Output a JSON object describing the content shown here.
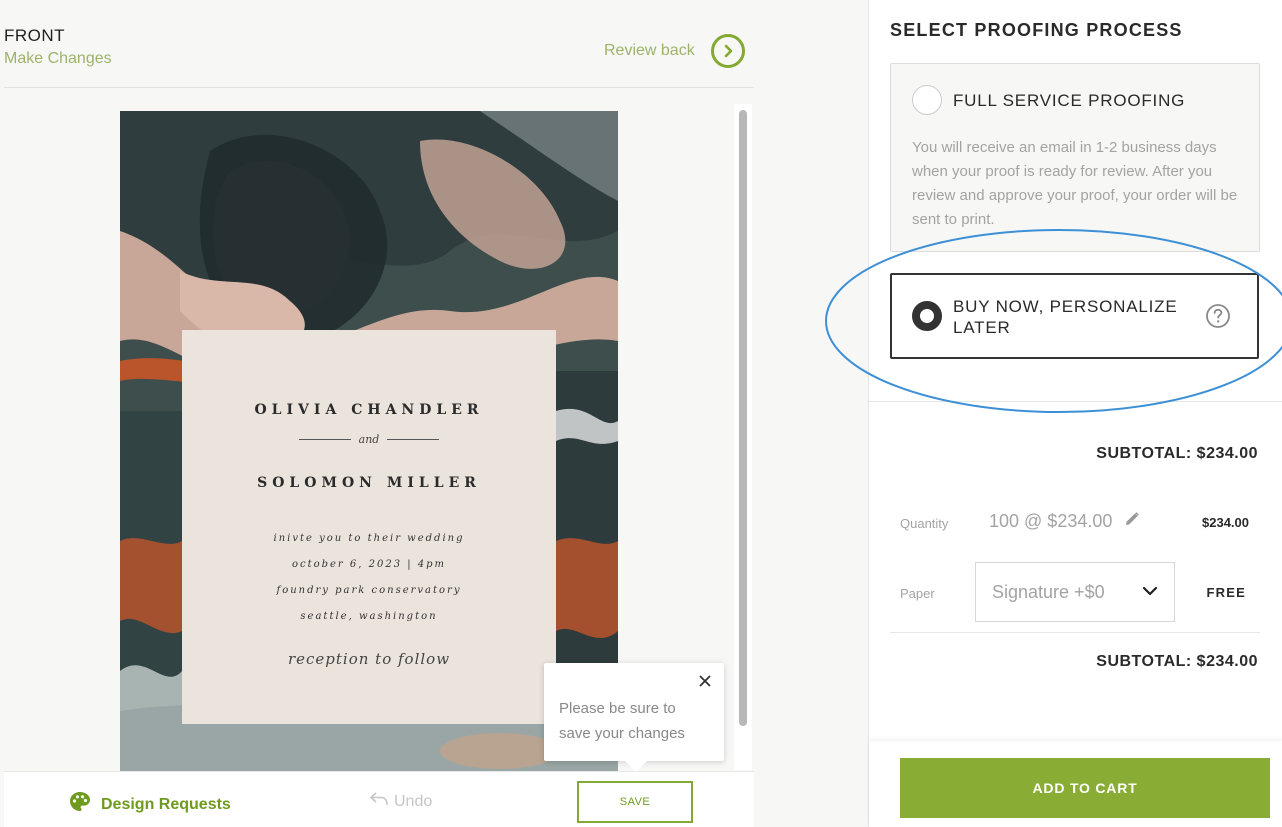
{
  "editor": {
    "side_title": "FRONT",
    "side_subtitle": "Make Changes",
    "review_link": "Review back"
  },
  "card": {
    "name1": "OLIVIA CHANDLER",
    "and": "and",
    "name2": "SOLOMON MILLER",
    "details": [
      "inivte you to their wedding",
      "october 6, 2023 | 4pm",
      "foundry park conservatory",
      "seattle, washington"
    ],
    "closing": "reception to follow"
  },
  "tooltip": {
    "text": "Please be sure to save your changes"
  },
  "bottom_bar": {
    "design_requests": "Design Requests",
    "undo": "Undo",
    "save": "SAVE"
  },
  "proofing": {
    "title": "SELECT PROOFING PROCESS",
    "full_service": {
      "label": "FULL SERVICE PROOFING",
      "description": "You will receive an email in 1-2 business days when your proof is ready for review. After you review and approve your proof, your order will be sent to print.",
      "selected": false
    },
    "buy_now": {
      "label": "BUY NOW, PERSONALIZE LATER",
      "selected": true
    }
  },
  "order": {
    "subtotal_top": "SUBTOTAL: $234.00",
    "quantity_label": "Quantity",
    "quantity_value": "100 @ $234.00",
    "quantity_price": "$234.00",
    "paper_label": "Paper",
    "paper_value": "Signature +$0",
    "paper_price": "FREE",
    "subtotal_bottom": "SUBTOTAL: $234.00",
    "add_to_cart": "ADD TO CART"
  },
  "colors": {
    "accent_green": "#89ac35",
    "link_green": "#9db36a",
    "highlight_blue": "#3d8fd6"
  },
  "icons": {
    "review": "chevron-right-circle-icon",
    "close": "close-icon",
    "palette": "palette-icon",
    "undo": "undo-icon",
    "edit": "pencil-icon",
    "dropdown": "chevron-down-icon",
    "help": "question-circle-icon"
  }
}
